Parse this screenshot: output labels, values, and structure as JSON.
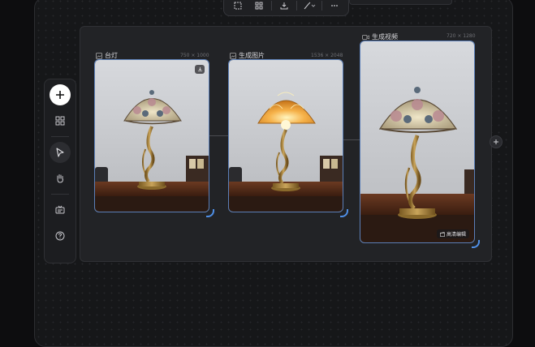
{
  "cards": [
    {
      "label": "台灯",
      "dims": "750 × 1000",
      "icon": "image-icon",
      "variant": "original"
    },
    {
      "label": "生成图片",
      "dims": "1536 × 2048",
      "icon": "image-icon",
      "variant": "lit"
    },
    {
      "label": "生成视频",
      "dims": "720 × 1280",
      "icon": "video-icon",
      "variant": "original",
      "action": "高清编辑"
    }
  ],
  "sidebar": [
    "add",
    "grid",
    "select",
    "hand",
    "frame",
    "help"
  ],
  "toolbar": [
    "crop",
    "grid",
    "download",
    "brush",
    "more"
  ],
  "colors": {
    "accent": "#4f8fe6",
    "card_border": "#5b7fb8",
    "board": "#222326"
  }
}
